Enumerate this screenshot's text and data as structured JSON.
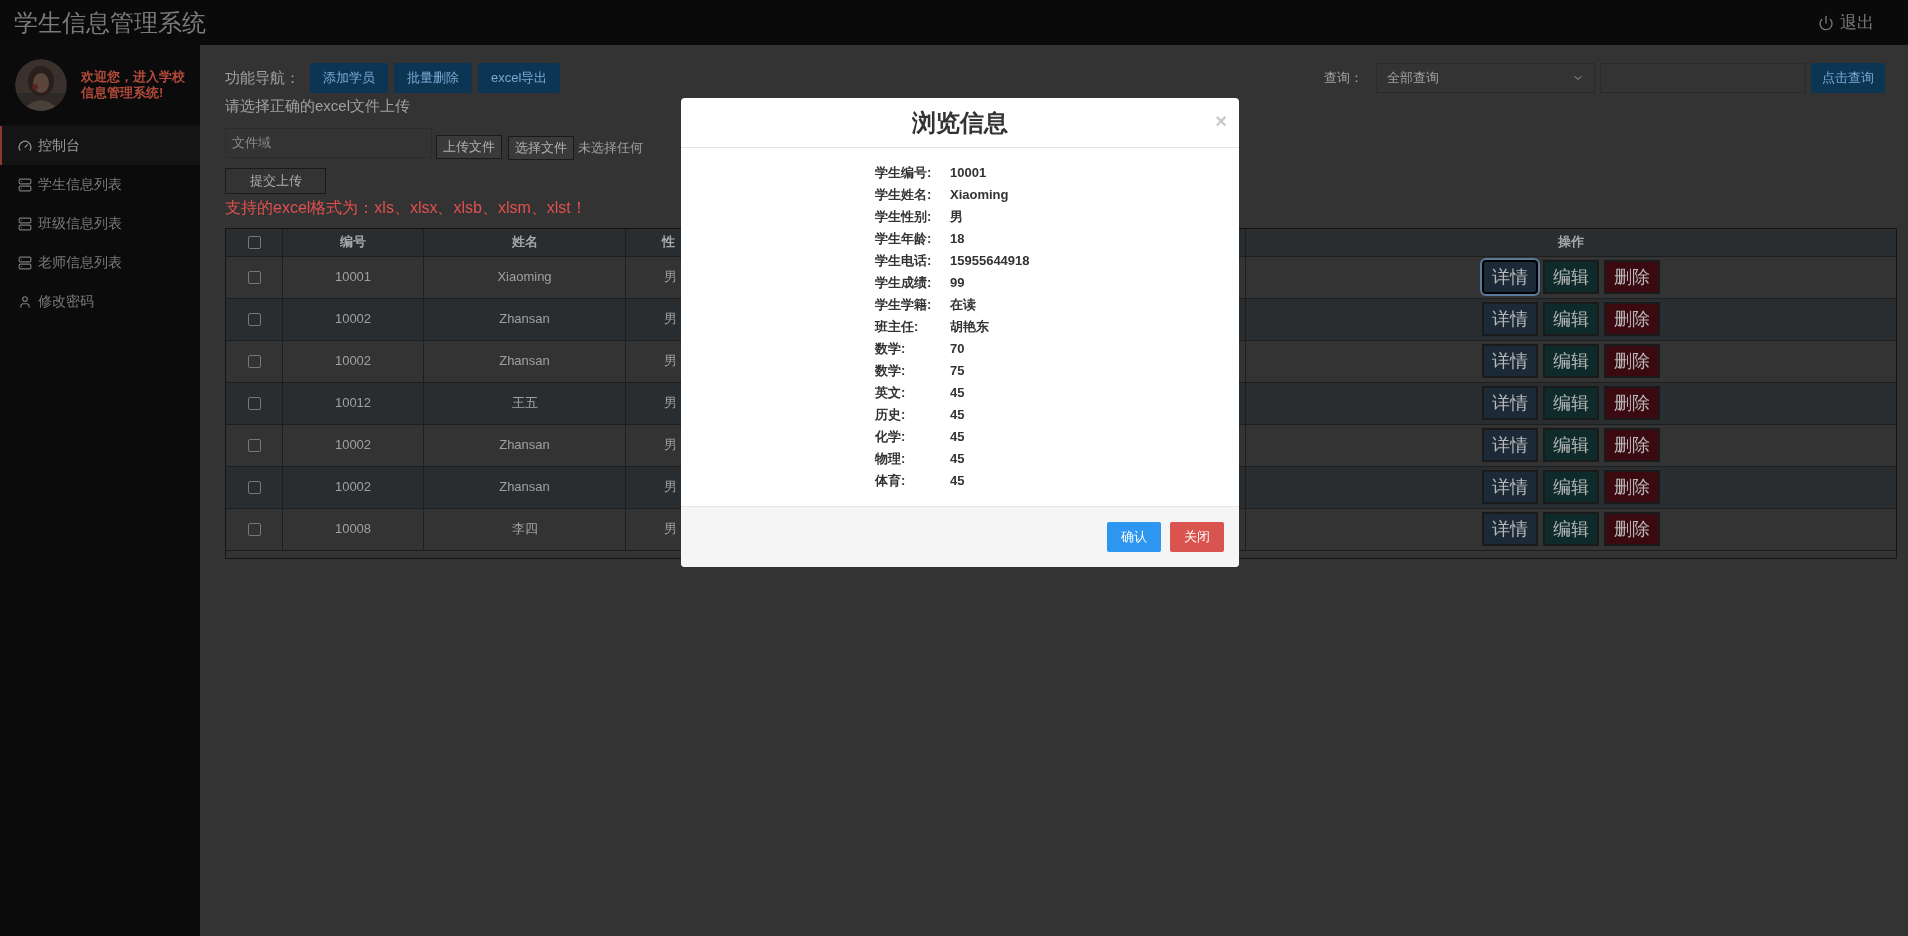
{
  "header": {
    "title": "学生信息管理系统",
    "logout": "退出"
  },
  "sidebar": {
    "welcome": "欢迎您，进入学校信息管理系统!",
    "items": [
      {
        "label": "控制台",
        "selected": true
      },
      {
        "label": "学生信息列表",
        "selected": false
      },
      {
        "label": "班级信息列表",
        "selected": false
      },
      {
        "label": "老师信息列表",
        "selected": false
      },
      {
        "label": "修改密码",
        "selected": false
      }
    ]
  },
  "toolbar": {
    "nav_label": "功能导航：",
    "buttons": [
      "添加学员",
      "批量删除",
      "excel导出"
    ],
    "query_label": "查询：",
    "query_select": "全部查询",
    "query_button": "点击查询"
  },
  "upload": {
    "hint": "请选择正确的excel文件上传",
    "file_placeholder": "文件域",
    "upload_button": "上传文件",
    "choose_button": "选择文件",
    "no_file": "未选择任何",
    "submit_button": "提交上传",
    "formats": "支持的excel格式为：xls、xlsx、xlsb、xlsm、xlst！"
  },
  "table": {
    "all_checked": false,
    "columns": [
      "编号",
      "姓名",
      "性",
      "操作"
    ],
    "rows": [
      {
        "checked": false,
        "id": "10001",
        "name": "Xiaoming",
        "gender": "男",
        "actions": [
          "详情",
          "编辑",
          "删除"
        ],
        "focused": true
      },
      {
        "checked": false,
        "id": "10002",
        "name": "Zhansan",
        "gender": "男",
        "actions": [
          "详情",
          "编辑",
          "删除"
        ],
        "focused": false
      },
      {
        "checked": false,
        "id": "10002",
        "name": "Zhansan",
        "gender": "男",
        "actions": [
          "详情",
          "编辑",
          "删除"
        ],
        "focused": false
      },
      {
        "checked": false,
        "id": "10012",
        "name": "王五",
        "gender": "男",
        "actions": [
          "详情",
          "编辑",
          "删除"
        ],
        "focused": false
      },
      {
        "checked": false,
        "id": "10002",
        "name": "Zhansan",
        "gender": "男",
        "actions": [
          "详情",
          "编辑",
          "删除"
        ],
        "focused": false
      },
      {
        "checked": false,
        "id": "10002",
        "name": "Zhansan",
        "gender": "男",
        "actions": [
          "详情",
          "编辑",
          "删除"
        ],
        "focused": false
      },
      {
        "checked": false,
        "id": "10008",
        "name": "李四",
        "gender": "男",
        "actions": [
          "详情",
          "编辑",
          "删除"
        ],
        "focused": false
      }
    ]
  },
  "modal": {
    "title": "浏览信息",
    "close": "×",
    "fields": [
      {
        "label": "学生编号:",
        "value": "10001"
      },
      {
        "label": "学生姓名:",
        "value": "Xiaoming"
      },
      {
        "label": "学生性别:",
        "value": "男"
      },
      {
        "label": "学生年龄:",
        "value": "18"
      },
      {
        "label": "学生电话:",
        "value": "15955644918"
      },
      {
        "label": "学生成绩:",
        "value": "99"
      },
      {
        "label": "学生学籍:",
        "value": "在读"
      },
      {
        "label": "班主任:",
        "value": "胡艳东"
      },
      {
        "label": "数学:",
        "value": "70"
      },
      {
        "label": "数学:",
        "value": "75"
      },
      {
        "label": "英文:",
        "value": "45"
      },
      {
        "label": "历史:",
        "value": "45"
      },
      {
        "label": "化学:",
        "value": "45"
      },
      {
        "label": "物理:",
        "value": "45"
      },
      {
        "label": "体育:",
        "value": "45"
      }
    ],
    "buttons": [
      {
        "label": "确认",
        "kind": "primary"
      },
      {
        "label": "关闭",
        "kind": "danger"
      }
    ]
  }
}
